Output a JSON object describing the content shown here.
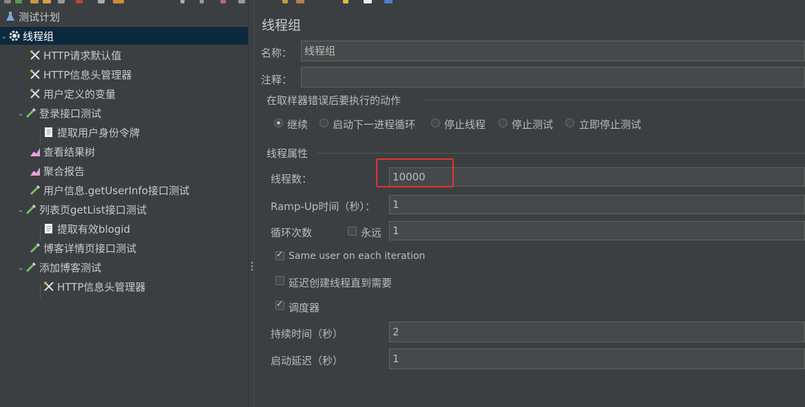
{
  "tree": {
    "items": [
      {
        "label": "测试计划",
        "icon": "flask-icon"
      },
      {
        "label": "线程组",
        "icon": "gear-icon"
      },
      {
        "label": "HTTP请求默认值",
        "icon": "wrench-icon"
      },
      {
        "label": "HTTP信息头管理器",
        "icon": "wrench-icon"
      },
      {
        "label": "用户定义的变量",
        "icon": "wrench-icon"
      },
      {
        "label": "登录接口测试",
        "icon": "pipette-icon"
      },
      {
        "label": "提取用户身份令牌",
        "icon": "document-icon"
      },
      {
        "label": "查看结果树",
        "icon": "graph-icon"
      },
      {
        "label": "聚合报告",
        "icon": "graph-icon"
      },
      {
        "label": "用户信息.getUserInfo接口测试",
        "icon": "pipette-icon"
      },
      {
        "label": "列表页getList接口测试",
        "icon": "pipette-icon"
      },
      {
        "label": "提取有效blogid",
        "icon": "document-icon"
      },
      {
        "label": "博客详情页接口测试",
        "icon": "pipette-icon"
      },
      {
        "label": "添加博客测试",
        "icon": "pipette-icon"
      },
      {
        "label": "HTTP信息头管理器",
        "icon": "wrench-icon"
      }
    ]
  },
  "panel": {
    "title": "线程组",
    "name_label": "名称：",
    "name_value": "线程组",
    "comment_label": "注释：",
    "comment_value": "",
    "error_section": "在取样器错误后要执行的动作",
    "error_options": [
      "继续",
      "启动下一进程循环",
      "停止线程",
      "停止测试",
      "立即停止测试"
    ],
    "thread_section": "线程属性",
    "threads_label": "线程数：",
    "threads_value": "10000",
    "rampup_label": "Ramp-Up时间（秒）：",
    "rampup_value": "1",
    "loop_label": "循环次数",
    "forever_label": "永远",
    "loop_value": "1",
    "same_user_label": "Same user on each iteration",
    "delay_label": "延迟创建线程直到需要",
    "scheduler_label": "调度器",
    "duration_label": "持续时间（秒）",
    "duration_value": "2",
    "startup_delay_label": "启动延迟（秒）",
    "startup_delay_value": "1"
  },
  "colors": {
    "selection": "#0d293e",
    "highlight_box": "#e03535",
    "background": "#3c3f41"
  }
}
